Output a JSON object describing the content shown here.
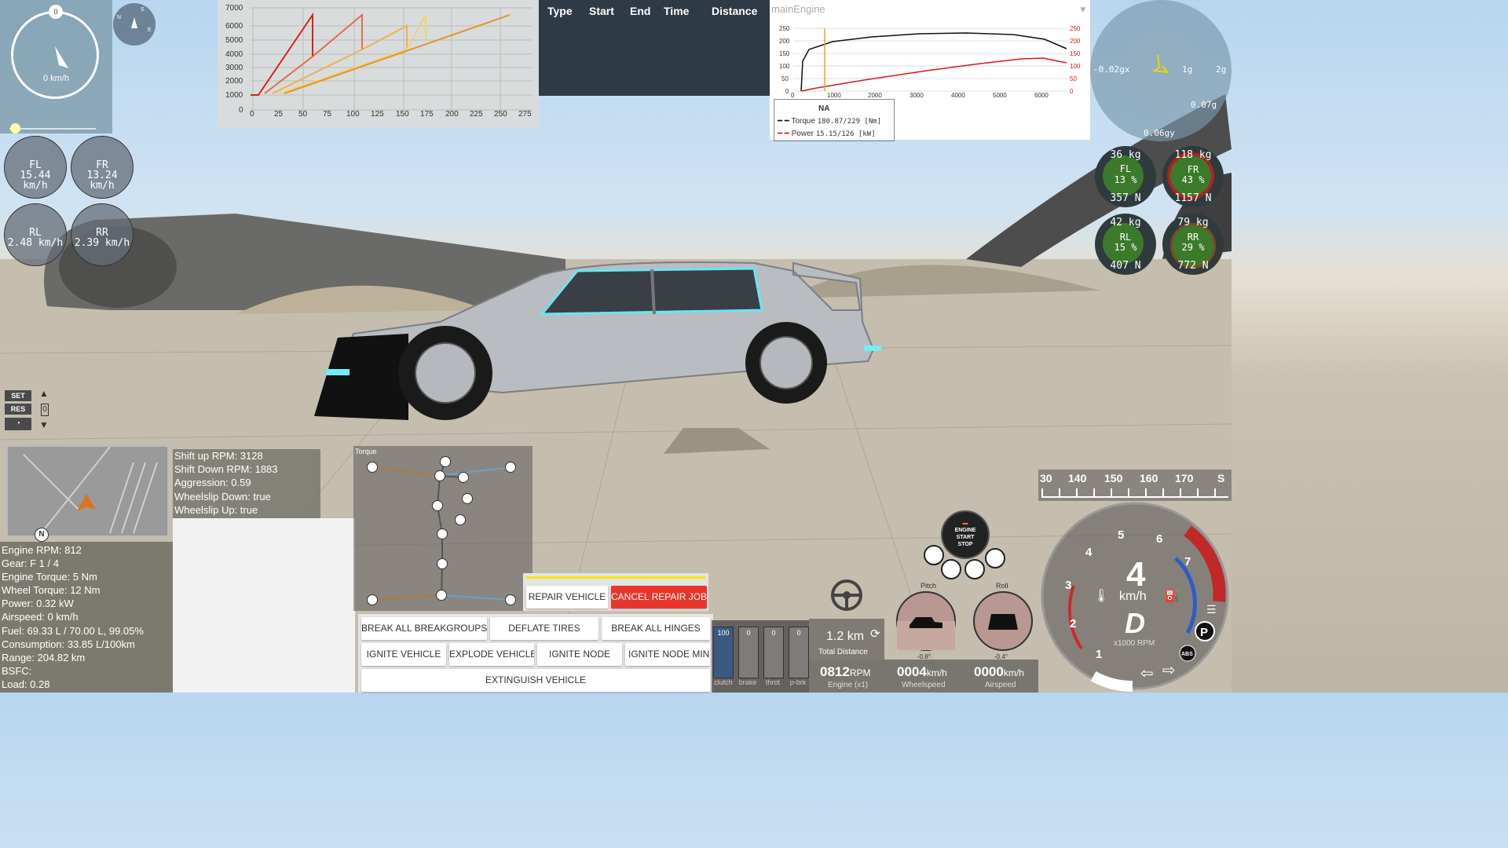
{
  "top_left": {
    "speed_zero": "0",
    "speed_unit": "0 km/h",
    "compass_letters": [
      "N",
      "E",
      "S"
    ]
  },
  "wheel_speeds": [
    {
      "label": "FL",
      "value": "15.44 km/h"
    },
    {
      "label": "FR",
      "value": "13.24 km/h"
    },
    {
      "label": "RL",
      "value": "2.48 km/h"
    },
    {
      "label": "RR",
      "value": "2.39 km/h"
    }
  ],
  "shift_chart": {
    "y_ticks": [
      "7000",
      "6000",
      "5000",
      "4000",
      "3000",
      "2000",
      "1000",
      "0"
    ],
    "x_ticks": [
      "0",
      "25",
      "50",
      "75",
      "100",
      "125",
      "150",
      "175",
      "200",
      "225",
      "250",
      "275"
    ]
  },
  "drag_table": {
    "headers": [
      "Type",
      "Start",
      "End",
      "Time",
      "Distance"
    ]
  },
  "torque_graph": {
    "select_label": "mainEngine",
    "left_ticks": [
      "250",
      "200",
      "150",
      "100",
      "50",
      "0"
    ],
    "right_ticks": [
      "250",
      "200",
      "150",
      "100",
      "50",
      "0"
    ],
    "x_ticks": [
      "0",
      "1000",
      "2000",
      "3000",
      "4000",
      "5000",
      "6000"
    ],
    "legend_title": "NA",
    "torque_label": "Torque",
    "torque_value": "180.87/229 [Nm]",
    "power_label": "Power",
    "power_value": "15.15/126  [kW]"
  },
  "gmeter": {
    "left_label": "-0.02gx",
    "ring1": "1g",
    "ring2": "2g",
    "right_value": "0.07g",
    "y_value": "0.06gy"
  },
  "tire_loads": [
    {
      "label": "FL",
      "load": "36 kg",
      "pct": "13 %",
      "force": "357 N"
    },
    {
      "label": "FR",
      "load": "118 kg",
      "pct": "43 %",
      "force": "1157 N"
    },
    {
      "label": "RL",
      "load": "42 kg",
      "pct": "15 %",
      "force": "407 N"
    },
    {
      "label": "RR",
      "load": "79 kg",
      "pct": "29 %",
      "force": "772 N"
    }
  ],
  "cruise": {
    "set": "SET",
    "res": "RES",
    "value": "0"
  },
  "minimap": {
    "north": "N"
  },
  "shift_info": [
    "Shift up RPM: 3128",
    "Shift Down RPM: 1883",
    "Aggression: 0.59",
    "Wheelslip Down: true",
    "Wheelslip Up: true"
  ],
  "engine_stats": [
    "Engine RPM: 812",
    "Gear: F 1 / 4",
    "Engine Torque: 5 Nm",
    "Wheel Torque: 12 Nm",
    "Power: 0.32 kW",
    "Airspeed: 0 km/h",
    "Fuel: 69.33 L / 70.00 L, 99.05%",
    "Consumption: 33.85 L/100km",
    "Range: 204.82 km",
    "BSFC:",
    "Load: 0.28"
  ],
  "torque_tree": {
    "title": "Torque"
  },
  "buttons": {
    "repair": "REPAIR VEHICLE",
    "cancel_repair": "CANCEL REPAIR JOB",
    "break_breakgroups": "BREAK ALL BREAKGROUPS",
    "deflate": "DEFLATE TIRES",
    "break_hinges": "BREAK ALL HINGES",
    "ignite_vehicle": "IGNITE VEHICLE",
    "explode": "EXPLODE VEHICLE",
    "ignite_node": "IGNITE NODE",
    "ignite_node_min": "IGNITE NODE MINIM",
    "extinguish": "EXTINGUISH VEHICLE"
  },
  "pedals": [
    {
      "label": "clutch",
      "value": "100",
      "level": 1.0
    },
    {
      "label": "brake",
      "value": "0",
      "level": 0
    },
    {
      "label": "throt",
      "value": "0",
      "level": 0
    },
    {
      "label": "p-brk",
      "value": "0",
      "level": 0
    }
  ],
  "trip": {
    "distance": "1.2 km",
    "label": "Total Distance"
  },
  "engine_button": {
    "line1": "ENGINE",
    "line2": "START",
    "line3": "STOP"
  },
  "attitude": {
    "pitch_label": "Pitch",
    "pitch_value": "-0.8°",
    "roll_label": "Roll",
    "roll_value": "-0.4°"
  },
  "digital": {
    "rpm_value": "0812",
    "rpm_unit": "RPM",
    "rpm_label": "Engine (x1)",
    "wheelspeed_value": "0004",
    "wheelspeed_unit": "km/h",
    "wheelspeed_label": "Wheelspeed",
    "airspeed_value": "0000",
    "airspeed_unit": "km/h",
    "airspeed_label": "Airspeed"
  },
  "heading_tape": [
    "30",
    "140",
    "150",
    "160",
    "170",
    "S"
  ],
  "main_gauge": {
    "ticks": [
      "1",
      "2",
      "3",
      "4",
      "5",
      "6",
      "7"
    ],
    "speed": "4",
    "unit": "km/h",
    "gear": "D",
    "rpm_label": "x1000 RPM",
    "park": "P",
    "abs": "ABS"
  },
  "colors": {
    "accent_red": "#e23b2e",
    "chart_bg": "#d8dcdc",
    "drag_bg": "#2e3a46",
    "load_green": "#3a7a2a",
    "load_red": "#b02020"
  }
}
